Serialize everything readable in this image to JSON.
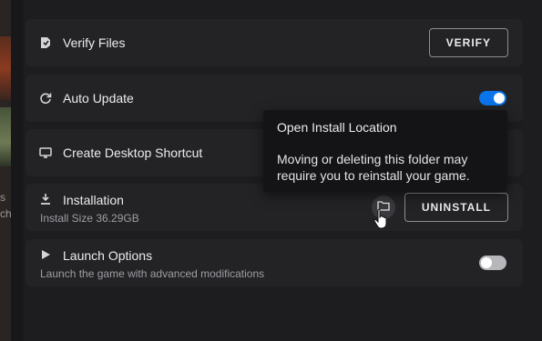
{
  "rows": {
    "verify": {
      "title": "Verify Files",
      "button": "VERIFY",
      "icon": "shield-check-icon"
    },
    "auto_update": {
      "title": "Auto Update",
      "enabled": true,
      "icon": "refresh-icon"
    },
    "desktop_shortcut": {
      "title": "Create Desktop Shortcut",
      "icon": "monitor-icon"
    },
    "installation": {
      "title": "Installation",
      "subtitle": "Install Size 36.29GB",
      "button": "UNINSTALL",
      "icon": "download-icon",
      "folder_icon": "folder-icon"
    },
    "launch_options": {
      "title": "Launch Options",
      "subtitle": "Launch the game with advanced modifications",
      "enabled": false,
      "icon": "play-icon"
    }
  },
  "tooltip": {
    "title": "Open Install Location",
    "body": "Moving or deleting this folder may require you to reinstall your game."
  },
  "background": {
    "partial_text_1": "s",
    "partial_text_2": "ch"
  },
  "colors": {
    "accent": "#0a74ea",
    "row_bg": "#232326",
    "page_bg": "#1d1d20"
  }
}
